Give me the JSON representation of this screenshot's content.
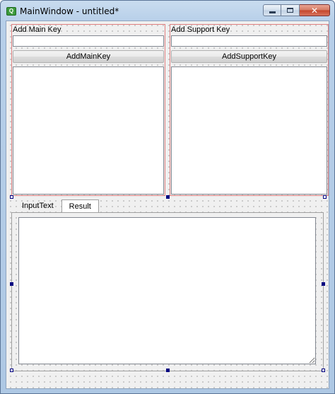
{
  "window": {
    "title": "MainWindow - untitled*",
    "app_icon": "qt-designer-icon",
    "close_label": "✕"
  },
  "main_key": {
    "label": "Add Main Key",
    "input_value": "",
    "button_label": "AddMainKey"
  },
  "support_key": {
    "label": "Add Support Key",
    "input_value": "",
    "button_label": "AddSupportKey"
  },
  "tabs": [
    {
      "label": "InputText",
      "active": false
    },
    {
      "label": "Result",
      "active": true
    }
  ],
  "colors": {
    "layout_border": "#e08080",
    "selection_handle": "#000080"
  }
}
